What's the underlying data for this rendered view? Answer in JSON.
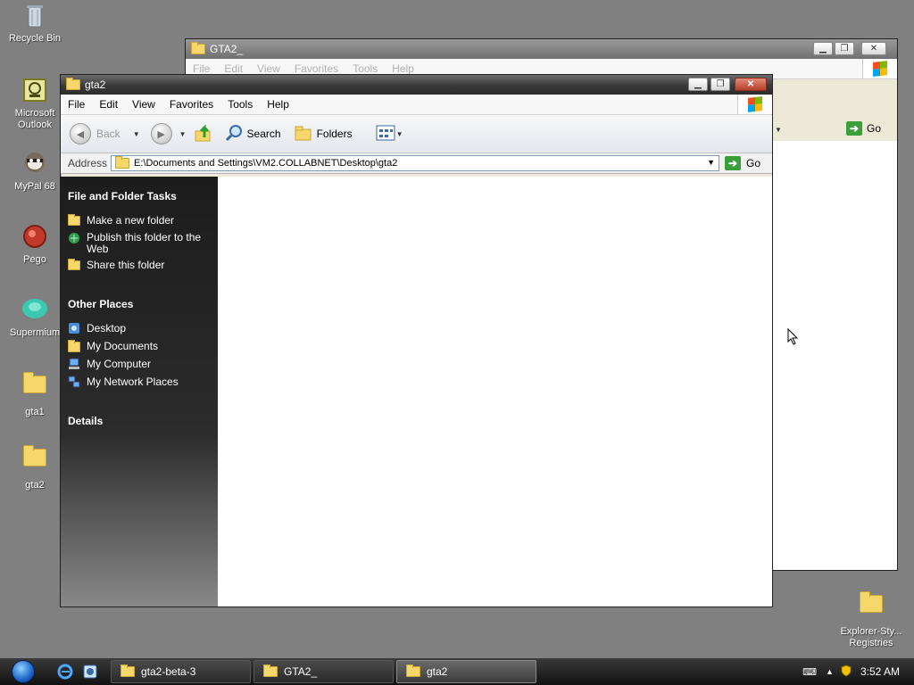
{
  "desktop": {
    "icons": [
      {
        "label": "Recycle Bin",
        "icon": "recycle-bin-icon"
      },
      {
        "label": "Microsoft\nOutlook",
        "icon": "outlook-icon"
      },
      {
        "label": "MyPal 68",
        "icon": "mypal-icon"
      },
      {
        "label": "Pego",
        "icon": "pego-icon"
      },
      {
        "label": "Supermium",
        "icon": "supermium-icon"
      },
      {
        "label": "gta1",
        "icon": "folder-icon"
      },
      {
        "label": "gta2",
        "icon": "folder-icon"
      },
      {
        "label": "Explorer-Sty...\nRegistries",
        "icon": "folder-icon"
      }
    ]
  },
  "back_window": {
    "title": "GTA2_",
    "menu": [
      "File",
      "Edit",
      "View",
      "Favorites",
      "Tools",
      "Help"
    ],
    "go_label": "Go"
  },
  "front_window": {
    "title": "gta2",
    "menu": [
      "File",
      "Edit",
      "View",
      "Favorites",
      "Tools",
      "Help"
    ],
    "toolbar": {
      "back_label": "Back",
      "search_label": "Search",
      "folders_label": "Folders"
    },
    "address": {
      "label": "Address",
      "value": "E:\\Documents and Settings\\VM2.COLLABNET\\Desktop\\gta2",
      "go_label": "Go"
    },
    "side_pane": {
      "file_tasks_heading": "File and Folder Tasks",
      "file_tasks": [
        "Make a new folder",
        "Publish this folder to the Web",
        "Share this folder"
      ],
      "other_places_heading": "Other Places",
      "other_places": [
        "Desktop",
        "My Documents",
        "My Computer",
        "My Network Places"
      ],
      "details_heading": "Details"
    }
  },
  "taskbar": {
    "buttons": [
      "gta2-beta-3",
      "GTA2_",
      "gta2"
    ],
    "active_index": 2,
    "clock": "3:52 AM"
  }
}
